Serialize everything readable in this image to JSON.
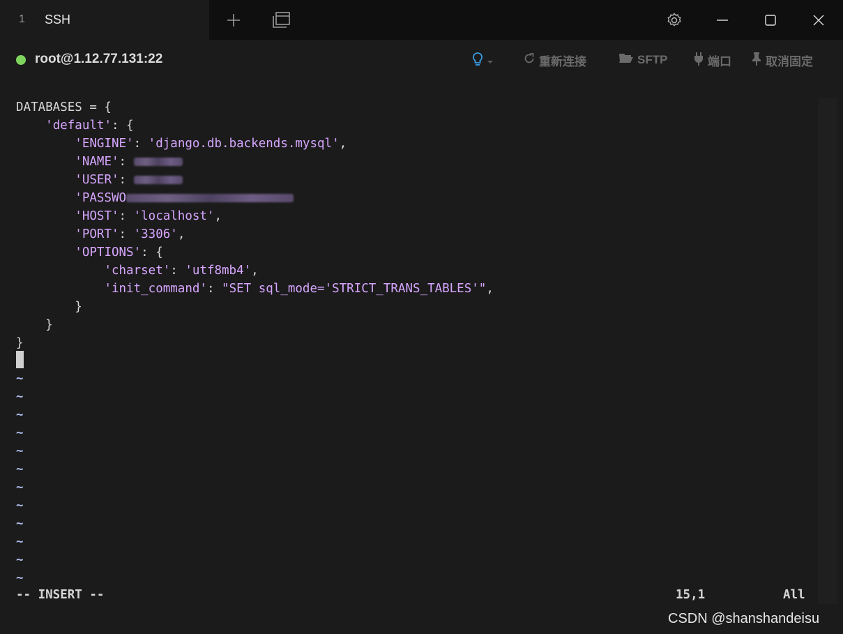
{
  "window": {
    "tab_number": "1",
    "tab_title": "SSH",
    "new_tab_icon": "plus-icon",
    "tab_overview_icon": "window-stack-icon",
    "settings_icon": "gear-icon",
    "minimize_icon": "minimize-icon",
    "maximize_icon": "maximize-icon",
    "close_icon": "close-icon"
  },
  "session": {
    "status_color": "#7fd45d",
    "host": "root@1.12.77.131:22",
    "actions": {
      "hint_icon": "lightbulb-icon",
      "reconnect": "重新连接",
      "sftp": "SFTP",
      "port": "端口",
      "unpin": "取消固定"
    }
  },
  "editor": {
    "lines": {
      "l1": "DATABASES = {",
      "l2_key": "'default'",
      "l2_rest": ": {",
      "l3_key": "'ENGINE'",
      "l3_sep": ": ",
      "l3_val": "'django.db.backends.mysql'",
      "l3_end": ",",
      "l4_key": "'NAME'",
      "l4_sep": ":",
      "l5_key": "'USER'",
      "l5_sep": ":",
      "l6_key": "'PASSWO",
      "l7_key": "'HOST'",
      "l7_sep": ": ",
      "l7_val": "'localhost'",
      "l7_end": ",",
      "l8_key": "'PORT'",
      "l8_sep": ": ",
      "l8_val": "'3306'",
      "l8_end": ",",
      "l9_key": "'OPTIONS'",
      "l9_rest": ": {",
      "l10_key": "'charset'",
      "l10_sep": ": ",
      "l10_val": "'utf8mb4'",
      "l10_end": ",",
      "l11_key": "'init_command'",
      "l11_sep": ": ",
      "l11_val": "\"SET sql_mode='STRICT_TRANS_TABLES'\"",
      "l11_end": ",",
      "l12": "}",
      "l13": "}",
      "l14": "}"
    },
    "tilde": "~",
    "mode": "-- INSERT --",
    "position": "15,1",
    "scroll": "All"
  },
  "watermark": "CSDN @shanshandeisu"
}
